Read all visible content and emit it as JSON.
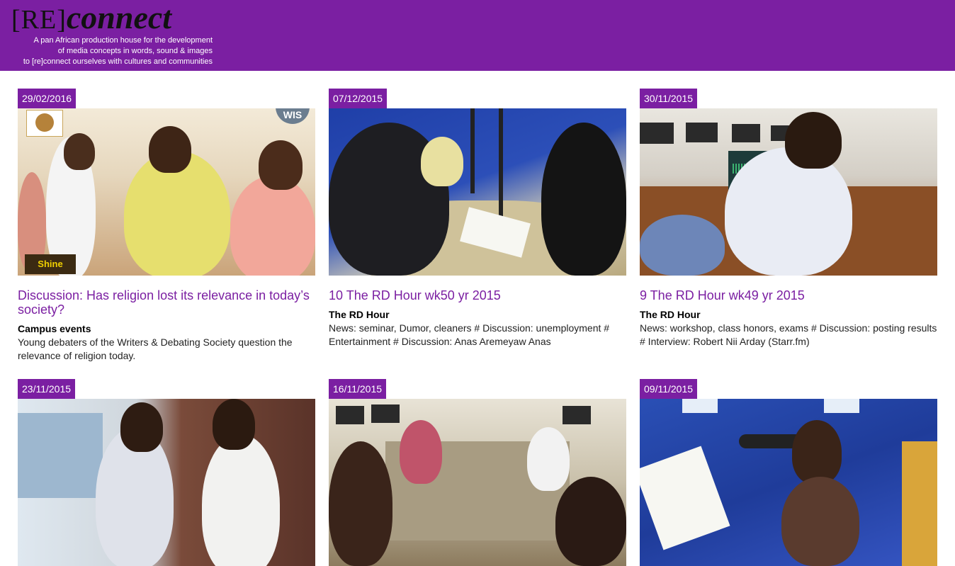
{
  "brand": {
    "logo_bracket": "[RE]",
    "logo_word": "connect",
    "tagline_lines": [
      "A pan African production house for the development",
      "of media concepts in words, sound & images",
      "to [re]connect ourselves with cultures and communities"
    ]
  },
  "colors": {
    "header": "#7b1fa2",
    "accent": "#7b1fa2"
  },
  "posts": [
    {
      "date": "29/02/2016",
      "title": "Discussion: Has religion lost its relevance in today’s society?",
      "category": "Campus events",
      "description": "Young debaters of the Writers & Debating Society question the relevance of religion today.",
      "thumb_badge_top": "WIS",
      "thumb_badge_bottom": "Shine"
    },
    {
      "date": "07/12/2015",
      "title": "10 The RD Hour wk50 yr 2015",
      "category": "The RD Hour",
      "description": "News: seminar, Dumor, cleaners # Discussion: unemployment # Entertainment # Discussion: Anas Aremeyaw Anas"
    },
    {
      "date": "30/11/2015",
      "title": "9 The RD Hour wk49 yr 2015",
      "category": "The RD Hour",
      "description": "News: workshop, class honors, exams # Discussion: posting results # Interview: Robert Nii Arday (Starr.fm)"
    },
    {
      "date": "23/11/2015"
    },
    {
      "date": "16/11/2015"
    },
    {
      "date": "09/11/2015"
    }
  ]
}
